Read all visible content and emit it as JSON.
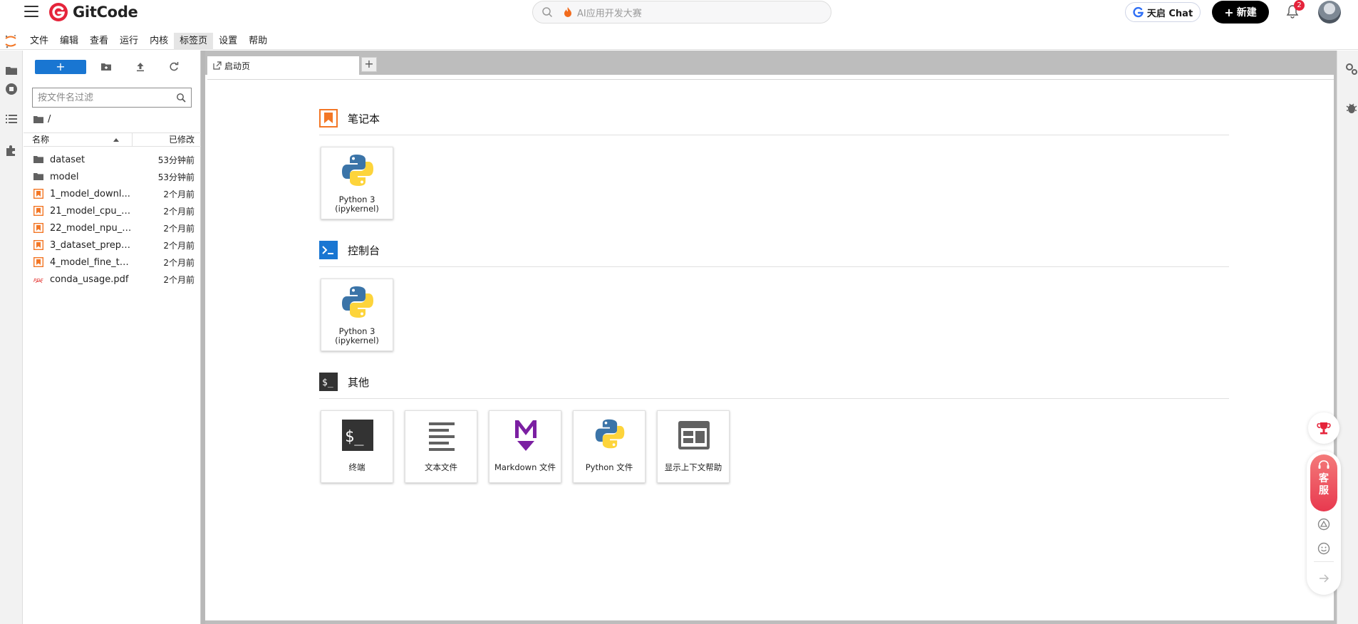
{
  "header": {
    "brand": "GitCode",
    "search_placeholder": "AI应用开发大赛",
    "chat_label": "天启 Chat",
    "new_label": "新建",
    "notification_count": "2"
  },
  "menubar": {
    "items": [
      "文件",
      "编辑",
      "查看",
      "运行",
      "内核",
      "标签页",
      "设置",
      "帮助"
    ],
    "active_index": 5
  },
  "filebrowser": {
    "new_label": "+",
    "filter_placeholder": "按文件名过滤",
    "breadcrumb": "/",
    "col_name": "名称",
    "col_modified": "已修改",
    "rows": [
      {
        "name": "dataset",
        "modified": "53分钟前",
        "icon": "folder-icon"
      },
      {
        "name": "model",
        "modified": "53分钟前",
        "icon": "folder-icon"
      },
      {
        "name": "1_model_downl...",
        "modified": "2个月前",
        "icon": "notebook-icon"
      },
      {
        "name": "21_model_cpu_i...",
        "modified": "2个月前",
        "icon": "notebook-icon"
      },
      {
        "name": "22_model_npu_i...",
        "modified": "2个月前",
        "icon": "notebook-icon"
      },
      {
        "name": "3_dataset_prepa...",
        "modified": "2个月前",
        "icon": "notebook-icon"
      },
      {
        "name": "4_model_fine_tu...",
        "modified": "2个月前",
        "icon": "notebook-icon"
      },
      {
        "name": "conda_usage.pdf",
        "modified": "2个月前",
        "icon": "pdf-icon"
      }
    ]
  },
  "tabs": [
    {
      "label": "启动页"
    }
  ],
  "launcher": {
    "notebook": {
      "title": "笔记本",
      "cards": [
        {
          "label": "Python 3\n(ipykernel)"
        }
      ]
    },
    "console": {
      "title": "控制台",
      "cards": [
        {
          "label": "Python 3\n(ipykernel)"
        }
      ]
    },
    "other": {
      "title": "其他",
      "cards": [
        {
          "label": "终端",
          "icon": "terminal-icon"
        },
        {
          "label": "文本文件",
          "icon": "text-file-icon"
        },
        {
          "label": "Markdown 文件",
          "icon": "markdown-icon"
        },
        {
          "label": "Python 文件",
          "icon": "python-icon"
        },
        {
          "label": "显示上下文帮助",
          "icon": "context-help-icon"
        }
      ]
    }
  },
  "float": {
    "service_label": "客服"
  },
  "colors": {
    "brand_red": "#e5243b",
    "jupyter_orange": "#f37726",
    "primary_blue": "#1976d2"
  }
}
